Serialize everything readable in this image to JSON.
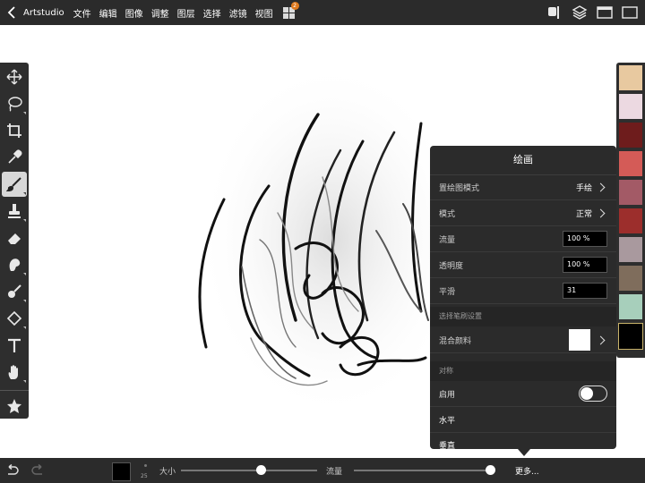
{
  "topbar": {
    "app_name": "Artstudio",
    "menus": [
      "文件",
      "编辑",
      "图像",
      "调整",
      "图层",
      "选择",
      "滤镜",
      "视图"
    ],
    "grid_badge": "2"
  },
  "panel": {
    "title": "绘画",
    "rows": [
      {
        "label": "置绘图模式",
        "value": "手绘"
      },
      {
        "label": "模式",
        "value": "正常"
      }
    ],
    "inputs": [
      {
        "label": "流量",
        "value": "100 %"
      },
      {
        "label": "透明度",
        "value": "100 %"
      },
      {
        "label": "平滑",
        "value": "31"
      }
    ],
    "brush_section": "选择笔刷设置",
    "mix_label": "混合颜料",
    "symmetry_section": "对称",
    "enable_label": "启用",
    "horizontal_label": "水平",
    "vertical_label": "垂直"
  },
  "bottombar": {
    "size_label": "大小",
    "size_value": "25",
    "size_fraction": 0.59,
    "flow_label": "流量",
    "flow_fraction": 1.0,
    "more_label": "更多..."
  },
  "swatches": [
    "#e8c9a0",
    "#ecd9e1",
    "#6e1c1c",
    "#d45b57",
    "#a35a66",
    "#9c2e2c",
    "#a9999e",
    "#7f6d5c",
    "#a7cfbb",
    "#000000"
  ],
  "colors": {
    "current": "#000000",
    "panel_bg": "#2b2b2b",
    "bar_bg": "#2b2b2b"
  }
}
